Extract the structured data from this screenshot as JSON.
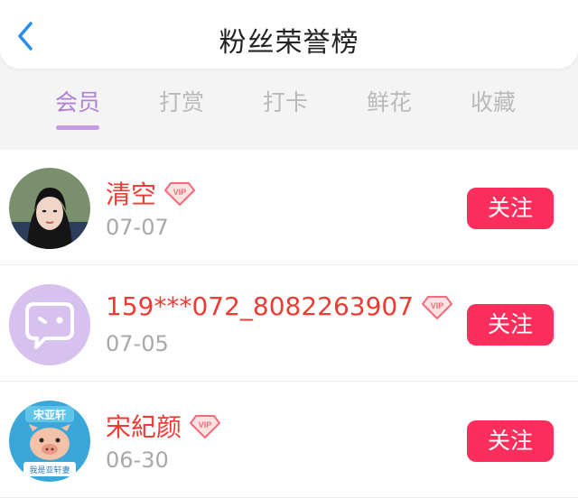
{
  "header": {
    "title": "粉丝荣誉榜",
    "back_icon": "chevron-left-icon"
  },
  "tabs": [
    {
      "label": "会员",
      "active": true
    },
    {
      "label": "打赏",
      "active": false
    },
    {
      "label": "打卡",
      "active": false
    },
    {
      "label": "鲜花",
      "active": false
    },
    {
      "label": "收藏",
      "active": false
    }
  ],
  "colors": {
    "accent": "#c69be6",
    "name": "#ee3b33",
    "follow": "#fd2e5c",
    "vip": "#f56b7a"
  },
  "fans": [
    {
      "name": "清空",
      "date": "07-07",
      "vip": true,
      "vip_label": "VIP",
      "follow_label": "关注",
      "avatar": "photo-avatar"
    },
    {
      "name": "159***072_8082263907",
      "date": "07-05",
      "vip": true,
      "vip_label": "VIP",
      "follow_label": "关注",
      "avatar": "default-chat-avatar"
    },
    {
      "name": "宋紀颜",
      "date": "06-30",
      "vip": true,
      "vip_label": "VIP",
      "follow_label": "关注",
      "avatar": "cartoon-avatar",
      "avatar_text_top": "宋亚轩",
      "avatar_text_bottom": "我是亚轩妻"
    }
  ]
}
